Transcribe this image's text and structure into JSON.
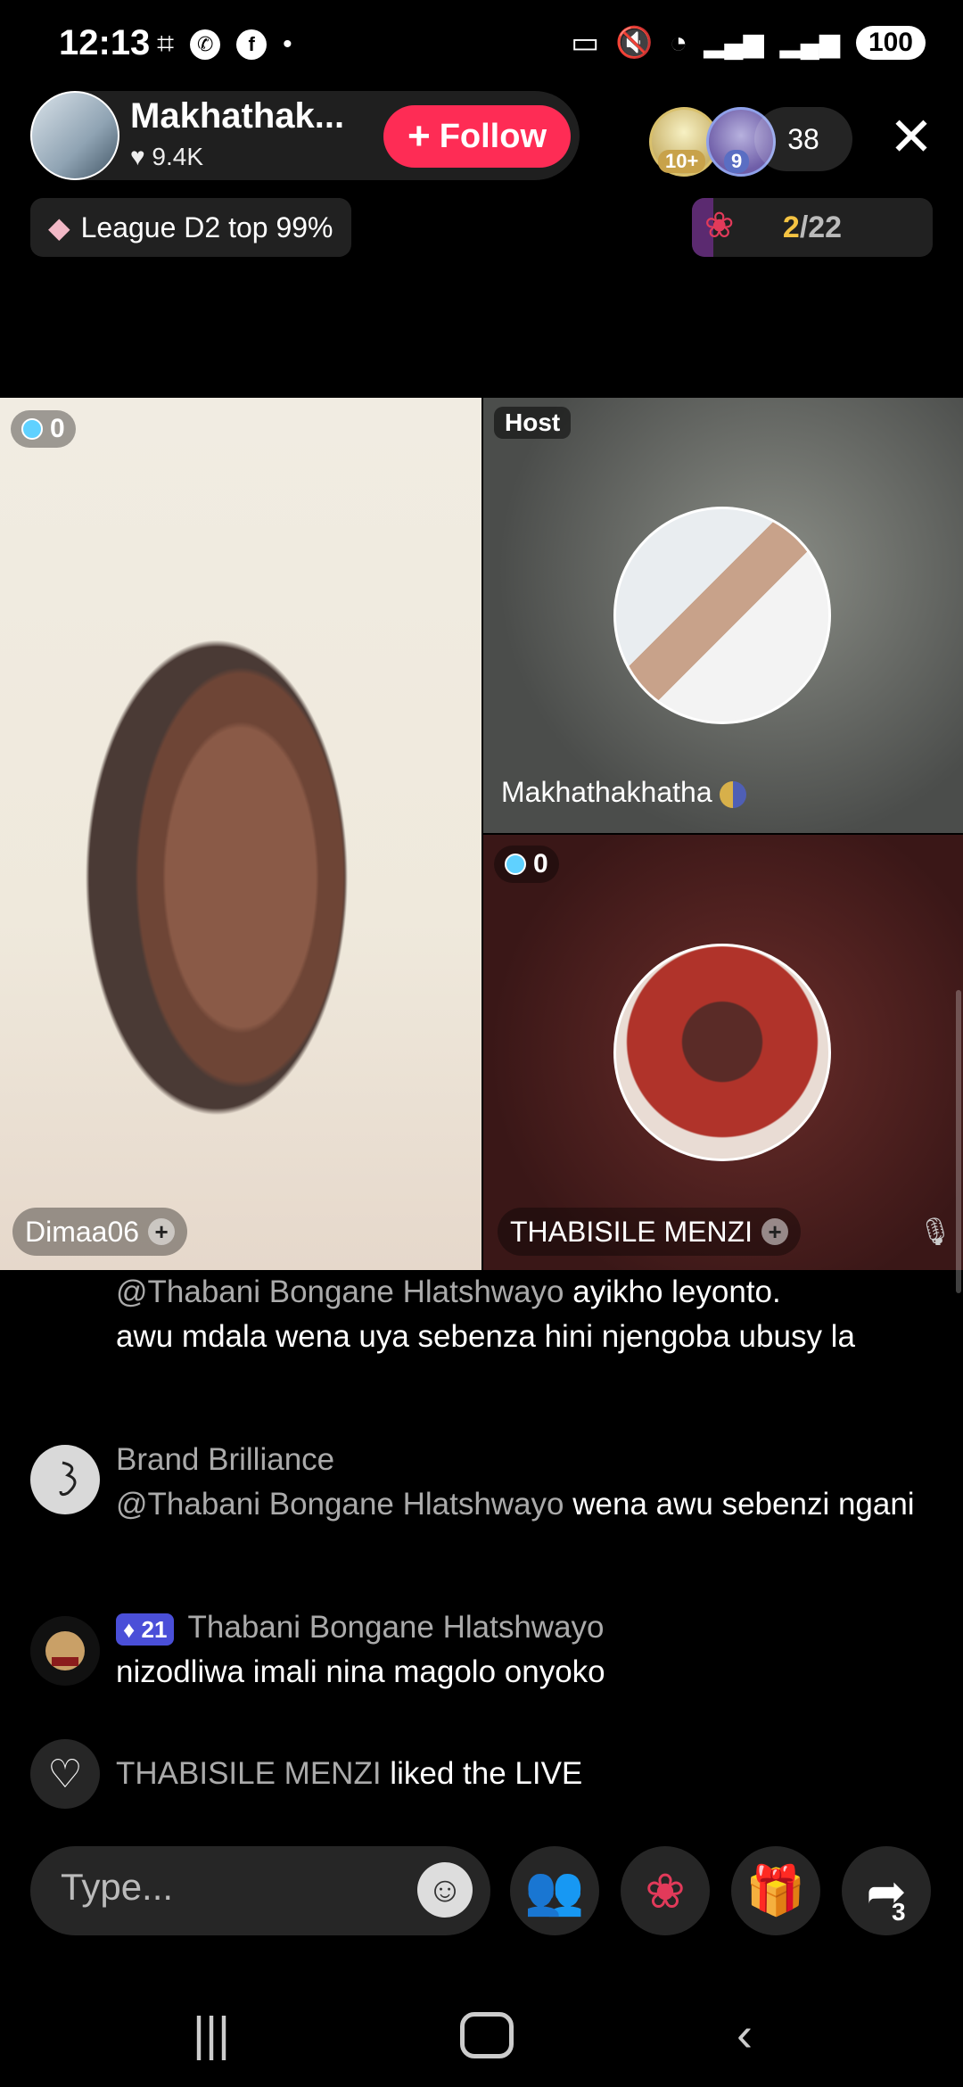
{
  "status_bar": {
    "time": "12:13",
    "left_icons": [
      "screenshot-icon",
      "whatsapp-icon",
      "facebook-icon",
      "dot-icon"
    ],
    "right_icons": [
      "cast-icon",
      "mute-icon",
      "wifi-icon",
      "signal-icon",
      "signal-icon"
    ],
    "battery": "100"
  },
  "header": {
    "host_name": "Makhathak...",
    "host_likes": "9.4K",
    "follow_label": "Follow",
    "viewer_badges": [
      "10+",
      "9"
    ],
    "viewer_count": "38",
    "close_symbol": "✕",
    "league_text": "League D2 top 99%",
    "rose_current": "2",
    "rose_total": "/22",
    "rose_progress": 0.09
  },
  "tiles": {
    "left": {
      "score": "0",
      "name": "Dimaa06"
    },
    "host": {
      "tag": "Host",
      "name": "Makhathakhatha"
    },
    "guest": {
      "score": "0",
      "name": "THABISILE MENZI"
    }
  },
  "chat": [
    {
      "user": "",
      "mention": "@Thabani Bongane Hlatshwayo",
      "text_partial": "ayikho leyonto.",
      "text": "awu mdala wena uya sebenza hini njengoba ubusy la"
    },
    {
      "user": "Brand Brilliance",
      "mention": "@Thabani Bongane Hlatshwayo",
      "text": "wena awu sebenzi ngani"
    },
    {
      "user": "Thabani Bongane Hlatshwayo",
      "level": "21",
      "text": "nizodliwa imali nina magolo onyoko"
    },
    {
      "user": "THABISILE MENZI",
      "text": "liked the LIVE"
    }
  ],
  "bottom_bar": {
    "type_placeholder": "Type...",
    "share_count": "3"
  },
  "colors": {
    "follow": "#fe2c55",
    "accent_gold": "#f5c342",
    "level_badge": "#4a4fd8"
  }
}
